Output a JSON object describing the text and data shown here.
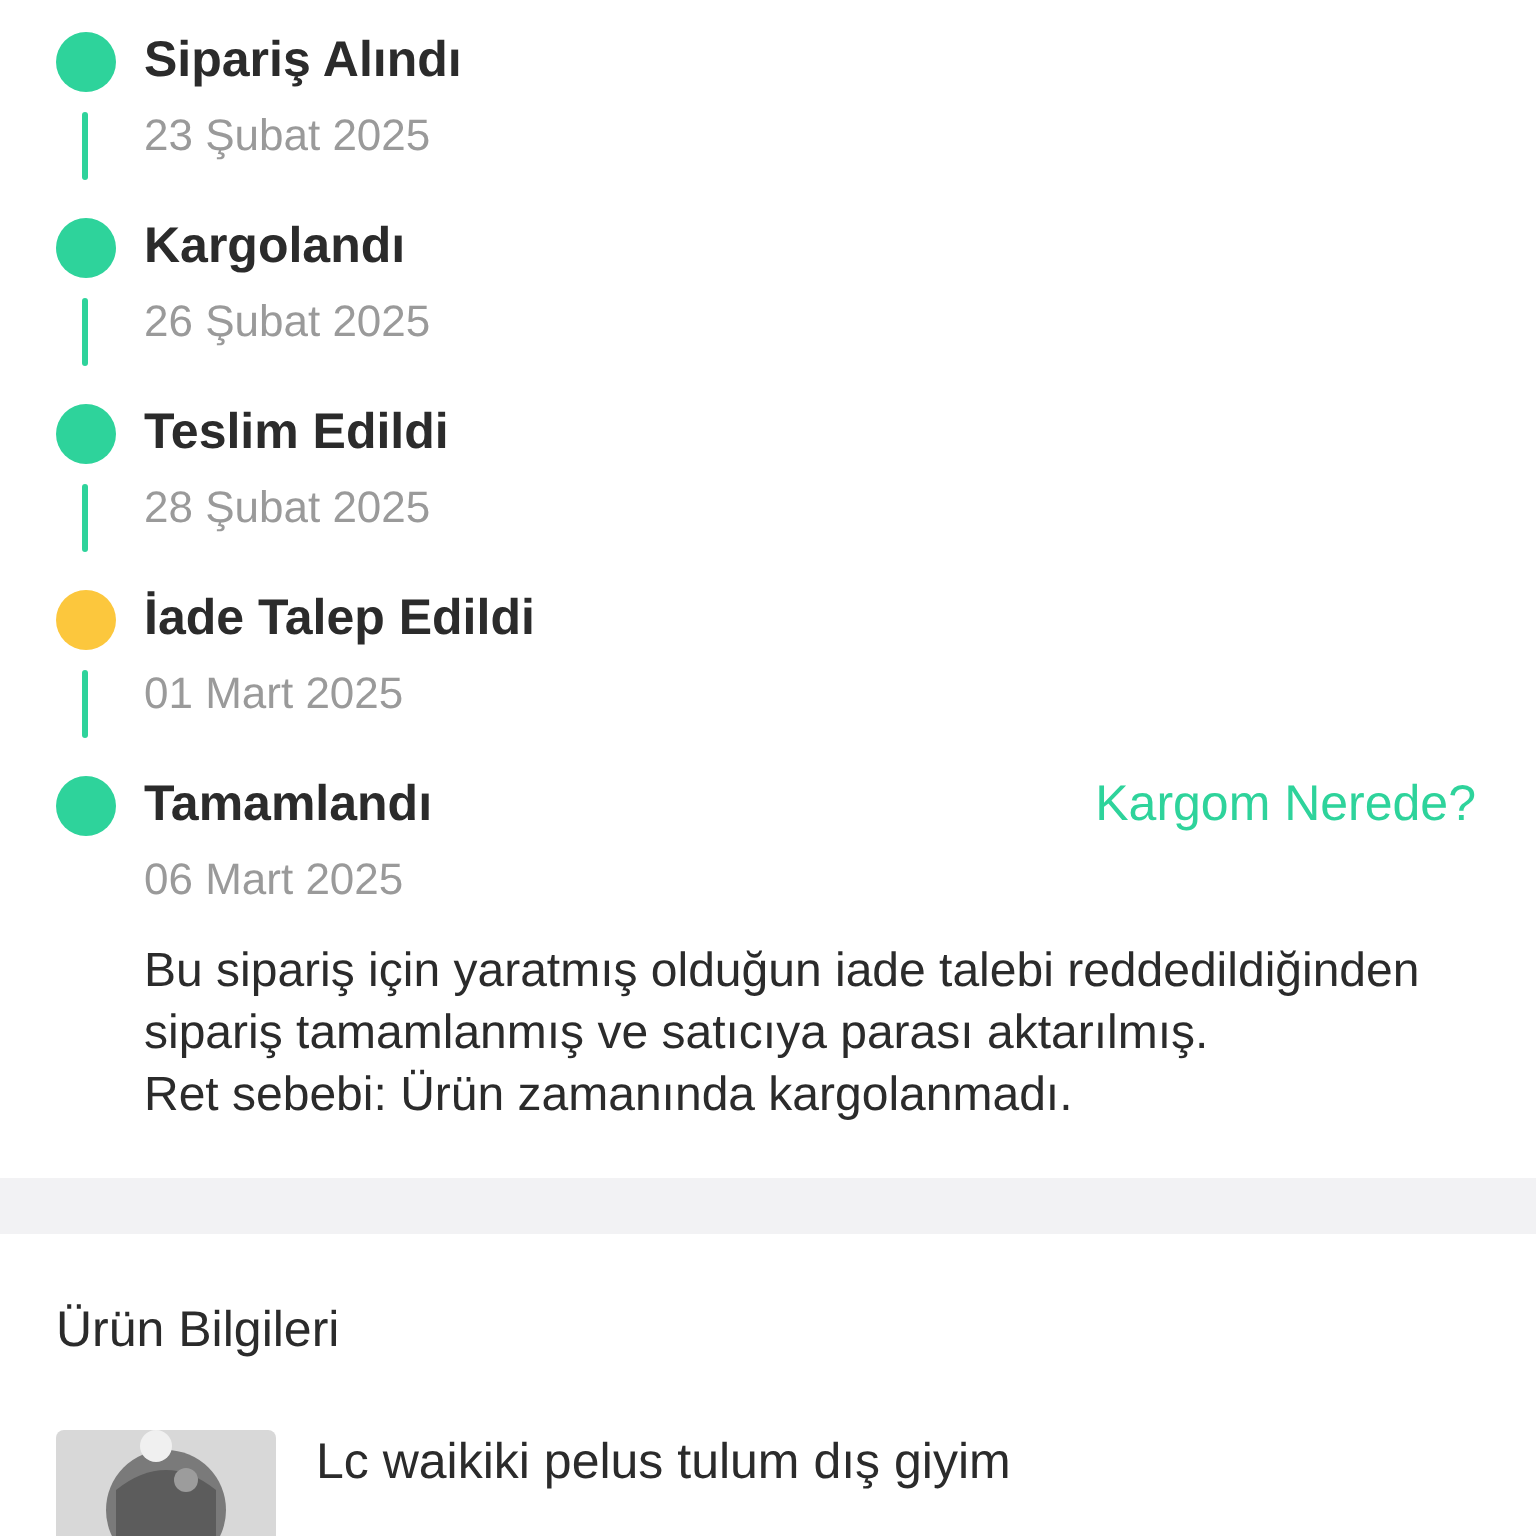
{
  "timeline": [
    {
      "title": "Sipariş Alındı",
      "date": "23 Şubat 2025",
      "color": "#2ed39b"
    },
    {
      "title": "Kargolandı",
      "date": "26 Şubat 2025",
      "color": "#2ed39b"
    },
    {
      "title": "Teslim Edildi",
      "date": "28 Şubat 2025",
      "color": "#2ed39b"
    },
    {
      "title": "İade Talep Edildi",
      "date": "01 Mart 2025",
      "color": "#fcc73d"
    },
    {
      "title": "Tamamlandı",
      "date": "06 Mart 2025",
      "color": "#2ed39b",
      "link": "Kargom Nerede?",
      "note_lines": [
        "Bu sipariş için yaratmış olduğun iade talebi reddedildiğinden sipariş tamamlanmış ve satıcıya parası aktarılmış.",
        "Ret sebebi: Ürün zamanında kargolanmadı."
      ]
    }
  ],
  "product_info": {
    "heading": "Ürün Bilgileri",
    "product": {
      "name": "Lc waikiki pelus tulum dış giyim"
    }
  }
}
